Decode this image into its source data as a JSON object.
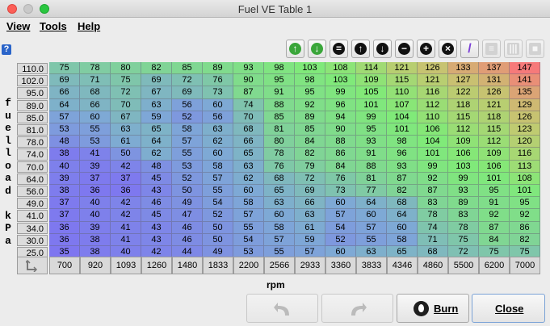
{
  "window": {
    "title": "Fuel VE Table 1"
  },
  "menu": {
    "view": "View",
    "tools": "Tools",
    "help": "Help"
  },
  "help_icon_glyph": "?",
  "toolbar": [
    {
      "name": "increment-icon",
      "color": "#3aa63a",
      "glyph": "↑"
    },
    {
      "name": "decrement-icon",
      "color": "#3aa63a",
      "glyph": "↓"
    },
    {
      "name": "set-equal-icon",
      "color": "#111111",
      "glyph": "="
    },
    {
      "name": "shift-up-icon",
      "color": "#111111",
      "glyph": "↑"
    },
    {
      "name": "shift-down-icon",
      "color": "#111111",
      "glyph": "↓"
    },
    {
      "name": "subtract-icon",
      "color": "#111111",
      "glyph": "−"
    },
    {
      "name": "add-icon",
      "color": "#111111",
      "glyph": "+"
    },
    {
      "name": "multiply-icon",
      "color": "#111111",
      "glyph": "×"
    },
    {
      "name": "interpolate-icon",
      "color": "#7b3fd6",
      "glyph": "/"
    },
    {
      "name": "horizontal-interpolate-icon",
      "color": "#999999",
      "glyph": "≡"
    },
    {
      "name": "vertical-interpolate-icon",
      "color": "#999999",
      "glyph": "|||"
    },
    {
      "name": "fill-icon",
      "color": "#999999",
      "glyph": "■"
    }
  ],
  "y_axis_label": "fuelload kPa",
  "x_axis_label": "rpm",
  "y_axis": [
    "110.0",
    "102.0",
    "95.0",
    "89.0",
    "85.0",
    "81.0",
    "78.0",
    "74.0",
    "70.0",
    "64.0",
    "56.0",
    "49.0",
    "41.0",
    "34.0",
    "30.0",
    "25.0"
  ],
  "x_axis": [
    "700",
    "920",
    "1093",
    "1260",
    "1480",
    "1833",
    "2200",
    "2566",
    "2933",
    "3360",
    "3833",
    "4346",
    "4860",
    "5500",
    "6200",
    "7000"
  ],
  "table": [
    [
      75,
      78,
      80,
      82,
      85,
      89,
      93,
      98,
      103,
      108,
      114,
      121,
      126,
      133,
      137,
      147
    ],
    [
      69,
      71,
      75,
      69,
      72,
      76,
      90,
      95,
      98,
      103,
      109,
      115,
      121,
      127,
      131,
      141
    ],
    [
      66,
      68,
      72,
      67,
      69,
      73,
      87,
      91,
      95,
      99,
      105,
      110,
      116,
      122,
      126,
      135
    ],
    [
      64,
      66,
      70,
      63,
      56,
      60,
      74,
      88,
      92,
      96,
      101,
      107,
      112,
      118,
      121,
      129
    ],
    [
      57,
      60,
      67,
      59,
      52,
      56,
      70,
      85,
      89,
      94,
      99,
      104,
      110,
      115,
      118,
      126
    ],
    [
      53,
      55,
      63,
      65,
      58,
      63,
      68,
      81,
      85,
      90,
      95,
      101,
      106,
      112,
      115,
      123
    ],
    [
      48,
      53,
      61,
      64,
      57,
      62,
      66,
      80,
      84,
      88,
      93,
      98,
      104,
      109,
      112,
      120
    ],
    [
      38,
      41,
      50,
      62,
      55,
      60,
      65,
      78,
      82,
      86,
      91,
      96,
      101,
      106,
      109,
      116
    ],
    [
      40,
      39,
      42,
      48,
      53,
      58,
      63,
      76,
      79,
      84,
      88,
      93,
      99,
      103,
      106,
      113
    ],
    [
      39,
      37,
      37,
      45,
      52,
      57,
      62,
      68,
      72,
      76,
      81,
      87,
      92,
      99,
      101,
      108
    ],
    [
      38,
      36,
      36,
      43,
      50,
      55,
      60,
      65,
      69,
      73,
      77,
      82,
      87,
      93,
      95,
      101
    ],
    [
      37,
      40,
      42,
      46,
      49,
      54,
      58,
      63,
      66,
      60,
      64,
      68,
      83,
      89,
      91,
      95
    ],
    [
      37,
      40,
      42,
      45,
      47,
      52,
      57,
      60,
      63,
      57,
      60,
      64,
      78,
      83,
      92,
      92
    ],
    [
      36,
      39,
      41,
      43,
      46,
      50,
      55,
      58,
      61,
      54,
      57,
      60,
      74,
      78,
      87,
      86
    ],
    [
      36,
      38,
      41,
      43,
      46,
      50,
      54,
      57,
      59,
      52,
      55,
      58,
      71,
      75,
      84,
      82
    ],
    [
      35,
      38,
      40,
      42,
      44,
      49,
      53,
      55,
      57,
      60,
      63,
      65,
      68,
      72,
      75,
      75
    ]
  ],
  "buttons": {
    "burn": "Burn",
    "close": "Close"
  }
}
